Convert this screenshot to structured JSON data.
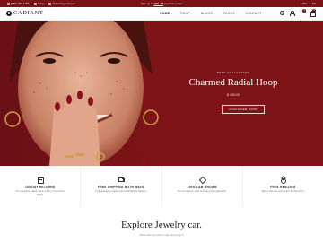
{
  "topbar": {
    "phone": "(888) 999 4785",
    "shop_label": "Shop",
    "appointment_label": "Virtual Appointment",
    "promo_text": "Sign up to",
    "promo_highlight": "10% off",
    "promo_tail": "your first order!",
    "currency": "USD",
    "language": "EN"
  },
  "header": {
    "logo_text": "CADIANT",
    "nav": [
      {
        "label": "HOME",
        "has_dropdown": true
      },
      {
        "label": "SHOP",
        "has_dropdown": true
      },
      {
        "label": "BLOGS",
        "has_dropdown": true
      },
      {
        "label": "PAGES",
        "has_dropdown": true
      },
      {
        "label": "CONTACT",
        "has_dropdown": false
      }
    ],
    "wishlist_count": "0",
    "cart_count": "0"
  },
  "hero": {
    "eyebrow": "BEST COLLECTION",
    "title": "Charmed Radial Hoop",
    "price": "$ 199.00",
    "cta_label": "DISCOVER NOW"
  },
  "features": [
    {
      "icon": "box-icon",
      "title": "100 DAY RETURNS",
      "desc": "\"No questions asked\" return policy. If you aren't happy."
    },
    {
      "icon": "truck-icon",
      "title": "FREE SHIPPING BOTH WAYS",
      "desc": "Your package is tracked and unlimited for delivery."
    },
    {
      "icon": "gem-icon",
      "title": "100% LAB GROWN",
      "desc": "We are proud to offer only lab grown diamonds."
    },
    {
      "icon": "ring-icon",
      "title": "FREE RESIZING",
      "desc": "Wasn't size you got it right? Fit doesn't fit."
    }
  ],
  "explore": {
    "title": "Explore Jewelry car.",
    "subtitle": "What can you come, find, and shop it"
  },
  "colors": {
    "brand": "#7a1216",
    "hero_bg": "#7e1417"
  }
}
